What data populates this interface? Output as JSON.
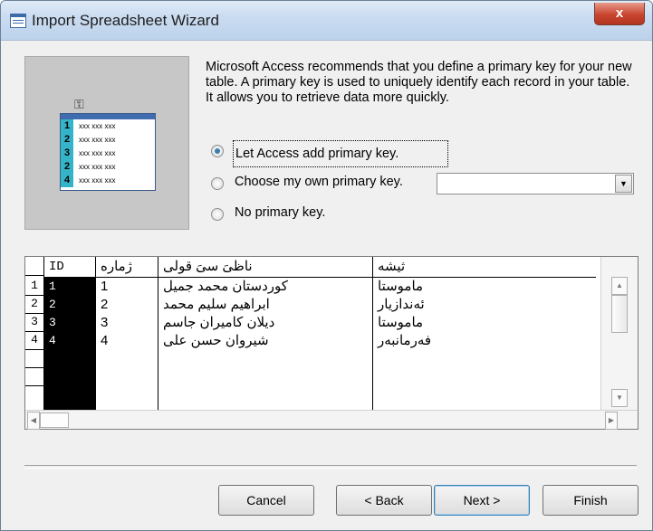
{
  "window": {
    "title": "Import Spreadsheet Wizard",
    "close_glyph": "x"
  },
  "illustration": {
    "rows": [
      {
        "num": "1",
        "text": "xxx xxx xxx"
      },
      {
        "num": "2",
        "text": "xxx xxx xxx"
      },
      {
        "num": "3",
        "text": "xxx xxx xxx"
      },
      {
        "num": "2",
        "text": "xxx xxx xxx"
      },
      {
        "num": "4",
        "text": "xxx xxx xxx"
      }
    ]
  },
  "description": "Microsoft Access recommends that you define a primary key for your new table. A primary key is used to uniquely identify each record in your table. It allows you to retrieve data more quickly.",
  "options": {
    "let_access": {
      "label": "Let Access add primary key.",
      "selected": true
    },
    "choose_own": {
      "label": "Choose my own primary key.",
      "selected": false
    },
    "no_key": {
      "label": "No primary key.",
      "selected": false
    }
  },
  "combo": {
    "value": ""
  },
  "grid": {
    "headers": {
      "id": "ID",
      "c1": "ژمارە",
      "c2": "ناظیَ سیَ قولی",
      "c3": "ثیشە"
    },
    "row_headers": [
      "1",
      "2",
      "3",
      "4",
      "",
      ""
    ],
    "rows": [
      {
        "id": "1",
        "c1": "1",
        "c2": "کوردستان محمد جمیل",
        "c3": "ماموستا"
      },
      {
        "id": "2",
        "c1": "2",
        "c2": "ابراهیم سلیم محمد",
        "c3": "ئەندازیار"
      },
      {
        "id": "3",
        "c1": "3",
        "c2": "دیلان کامیران جاسم",
        "c3": "ماموستا"
      },
      {
        "id": "4",
        "c1": "4",
        "c2": "شیروان حسن علی",
        "c3": "فەرمانبەر"
      }
    ]
  },
  "buttons": {
    "cancel": "Cancel",
    "back": "< Back",
    "next": "Next >",
    "finish": "Finish"
  }
}
